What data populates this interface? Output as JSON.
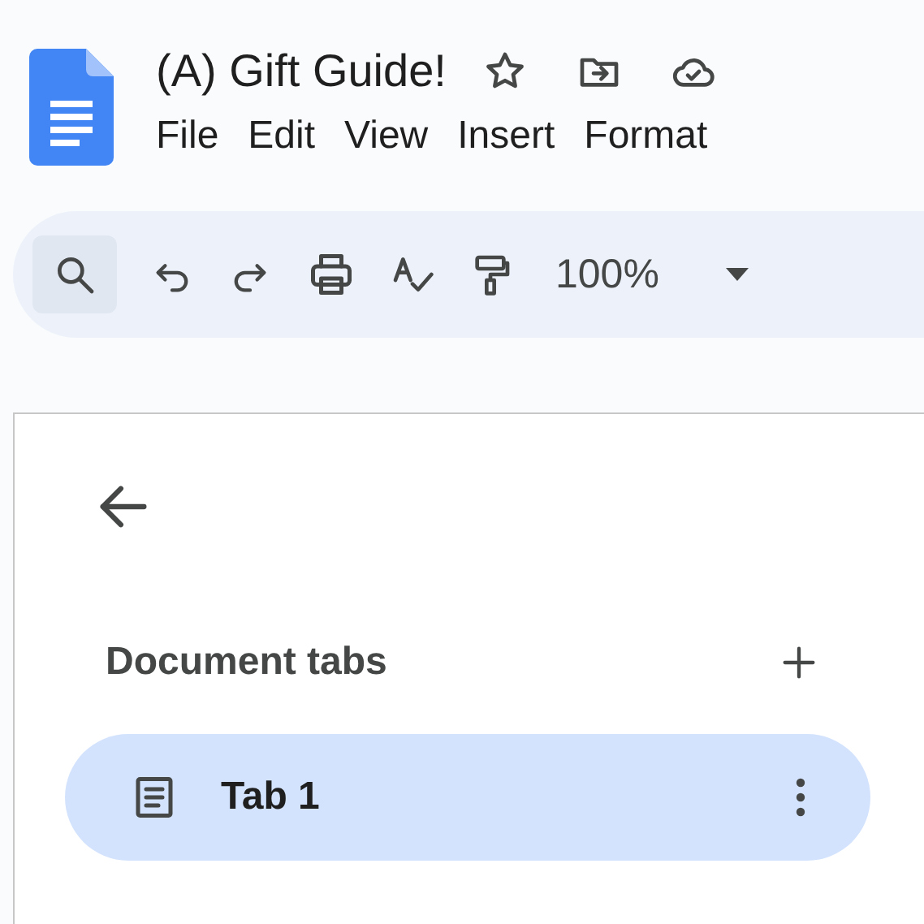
{
  "document": {
    "title": "(A) Gift Guide!"
  },
  "menu": [
    "File",
    "Edit",
    "View",
    "Insert",
    "Format"
  ],
  "toolbar": {
    "zoom": "100%"
  },
  "tabs_panel": {
    "heading": "Document tabs",
    "tabs": [
      {
        "label": "Tab 1",
        "selected": true
      }
    ]
  }
}
